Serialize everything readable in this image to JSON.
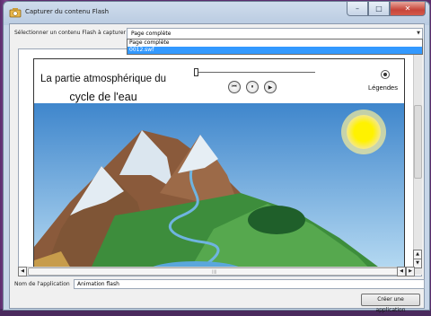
{
  "window": {
    "title": "Capturer du contenu Flash",
    "controls": {
      "minimize": "–",
      "maximize": "□",
      "close": "✕"
    }
  },
  "selector": {
    "label": "Sélectionner un contenu Flash à capturer",
    "value": "Page complète",
    "options": [
      "Page complète",
      "0012.swf"
    ],
    "highlighted_option": "0012.swf"
  },
  "flash": {
    "title_line1": "La partie atmosphérique du",
    "title_line2": "cycle de l'eau",
    "legend_label": "Légendes",
    "controls": {
      "rewind": "⏮",
      "pause": "⏸",
      "play": "▶"
    }
  },
  "application": {
    "name_label": "Nom de l'application",
    "name_value": "Animation flash",
    "create_button": "Créer une application"
  },
  "scroll": {
    "up": "▲",
    "down": "▼",
    "left": "◀",
    "right": "▶",
    "grip": "||||"
  }
}
